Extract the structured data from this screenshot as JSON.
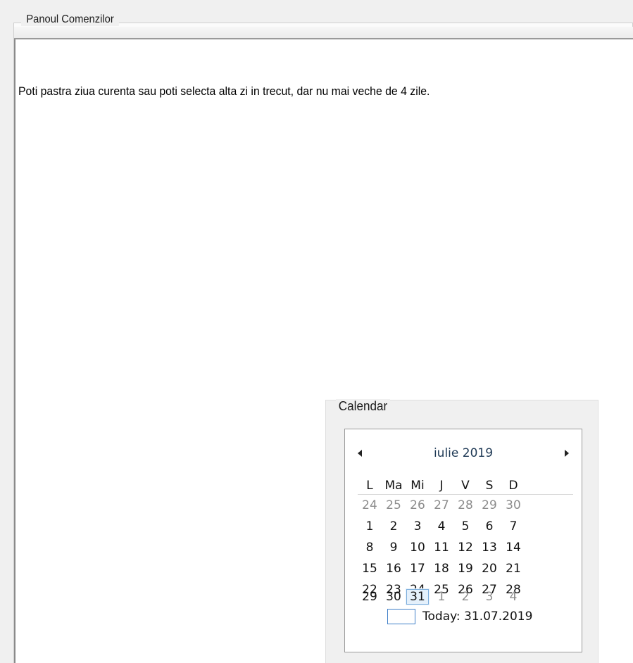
{
  "panel": {
    "title": "Panoul Comenzilor",
    "message": "Poti pastra ziua curenta sau poti selecta alta zi in trecut, dar nu mai veche de 4 zile."
  },
  "calendar": {
    "group_title": "Calendar",
    "month_label": "iulie 2019",
    "weekdays": [
      "L",
      "Ma",
      "Mi",
      "J",
      "V",
      "S",
      "D"
    ],
    "weeks": [
      [
        "24",
        "25",
        "26",
        "27",
        "28",
        "29",
        "30"
      ],
      [
        "1",
        "2",
        "3",
        "4",
        "5",
        "6",
        "7"
      ],
      [
        "8",
        "9",
        "10",
        "11",
        "12",
        "13",
        "14"
      ],
      [
        "15",
        "16",
        "17",
        "18",
        "19",
        "20",
        "21"
      ],
      [
        "22",
        "23",
        "24",
        "25",
        "26",
        "27",
        "28"
      ],
      [
        "29",
        "30",
        "31",
        "1",
        "2",
        "3",
        "4"
      ]
    ],
    "selected": "31",
    "today_label": "Today: 31.07.2019",
    "colors": {
      "month_text": "#1e3955",
      "other_month": "#8c8c8c",
      "selected_border": "#7daedc",
      "today_border": "#3f7fc8"
    }
  }
}
